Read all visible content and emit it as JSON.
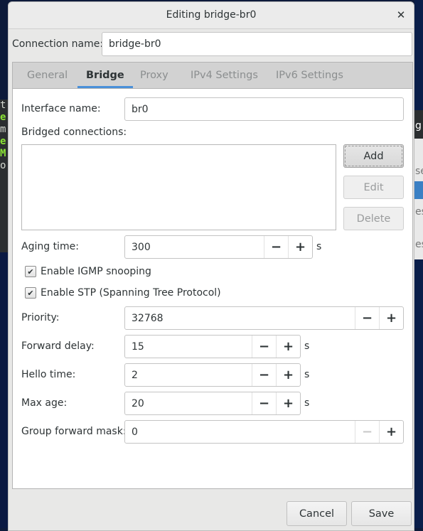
{
  "window": {
    "title": "Editing bridge-br0",
    "close_icon": "close-icon"
  },
  "connection_name": {
    "label": "Connection name:",
    "value": "bridge-br0"
  },
  "tabs": [
    {
      "label": "General",
      "active": false
    },
    {
      "label": "Bridge",
      "active": true
    },
    {
      "label": "Proxy",
      "active": false
    },
    {
      "label": "IPv4 Settings",
      "active": false
    },
    {
      "label": "IPv6 Settings",
      "active": false
    }
  ],
  "bridge": {
    "interface_name": {
      "label": "Interface name:",
      "value": "br0"
    },
    "bridged_connections": {
      "label": "Bridged connections:",
      "items": []
    },
    "buttons": {
      "add": "Add",
      "edit": "Edit",
      "delete": "Delete"
    },
    "aging_time": {
      "label": "Aging time:",
      "value": "300",
      "unit": "s"
    },
    "igmp_snooping": {
      "label": "Enable IGMP snooping",
      "checked": true
    },
    "stp": {
      "label": "Enable STP (Spanning Tree Protocol)",
      "checked": true
    },
    "priority": {
      "label": "Priority:",
      "value": "32768"
    },
    "forward_delay": {
      "label": "Forward delay:",
      "value": "15",
      "unit": "s"
    },
    "hello_time": {
      "label": "Hello time:",
      "value": "2",
      "unit": "s"
    },
    "max_age": {
      "label": "Max age:",
      "value": "20",
      "unit": "s"
    },
    "group_forward_mask": {
      "label": "Group forward mask:",
      "value": "0"
    }
  },
  "spin_glyphs": {
    "minus": "−",
    "plus": "+",
    "check": "✔"
  },
  "footer": {
    "cancel": "Cancel",
    "save": "Save"
  },
  "background": {
    "terminal_fragments": [
      "t",
      "e",
      "m",
      "e",
      "M",
      "o"
    ],
    "right_fragments": [
      "g",
      "se",
      "es",
      "es"
    ]
  }
}
